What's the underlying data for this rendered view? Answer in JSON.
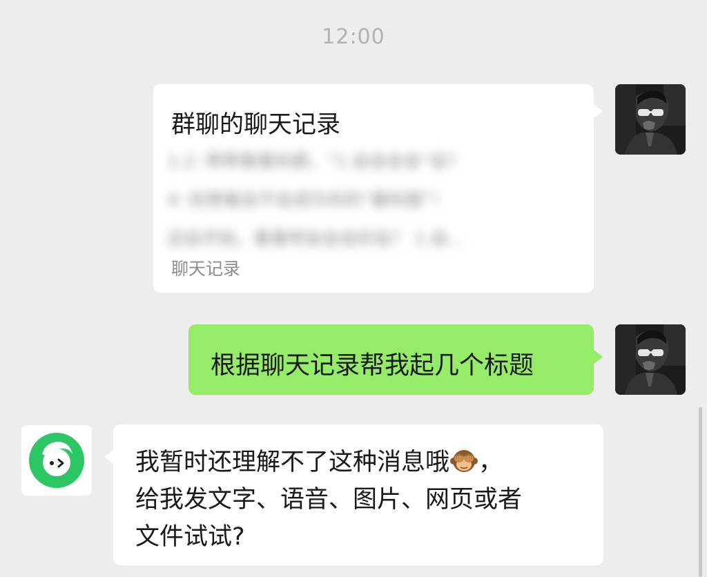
{
  "timestamp": "12:00",
  "chat_record_card": {
    "title": "群聊的聊天记录",
    "preview_lines": [
      "1.2: 帮帮看看标题，“1.会会会会”会？",
      "4: 别想着会不会成为你的“最标题”！",
      "这会开始，看看吧会会会好会？ 1.会..."
    ],
    "footer": "聊天记录"
  },
  "user_message": {
    "text": "根据聊天记录帮我起几个标题"
  },
  "bot_message": {
    "line1_before_emoji": "我暂时还理解不了这种消息哦",
    "emoji": "see-no-evil-monkey",
    "line1_after_emoji": "，",
    "line2": "给我发文字、语音、图片、网页或者",
    "line3": "文件试试?"
  },
  "colors": {
    "background": "#ededed",
    "bubble_white": "#ffffff",
    "bubble_green": "#95ec69",
    "bot_avatar_green": "#2cc665",
    "text_primary": "#191919",
    "text_secondary": "#8c8c8c",
    "timestamp": "#b2b2b2"
  },
  "icons": {
    "user_avatar": "user-avatar-photo",
    "bot_avatar": "bot-logo-icon"
  }
}
